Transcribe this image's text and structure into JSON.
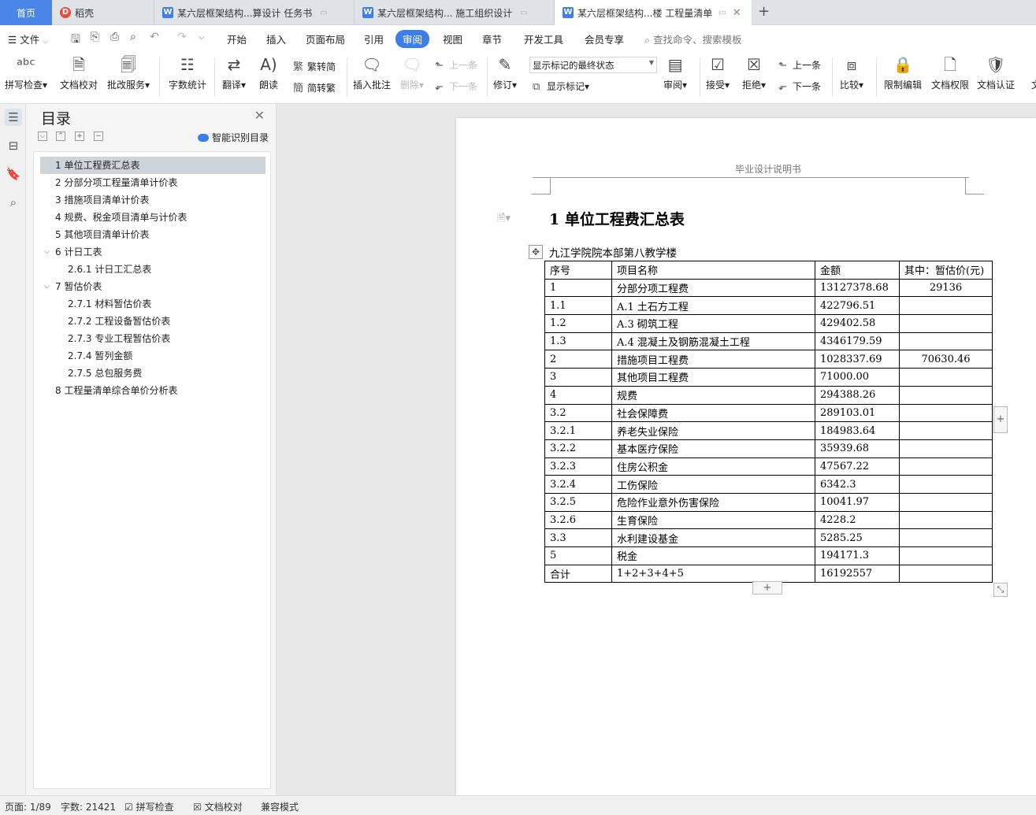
{
  "tabs": {
    "home": "首页",
    "t1": "稻壳",
    "t2": "某六层框架结构...算设计 任务书",
    "t3": "某六层框架结构... 施工组织设计",
    "t4": "某六层框架结构...楼 工程量清单"
  },
  "menu": {
    "file": "文件",
    "items": [
      "开始",
      "插入",
      "页面布局",
      "引用",
      "审阅",
      "视图",
      "章节",
      "开发工具",
      "会员专享"
    ],
    "search": "查找命令、搜索模板"
  },
  "ribbon": {
    "spell": "拼写检查",
    "proof": "文档校对",
    "revise_service": "批改服务",
    "wordcount": "字数统计",
    "translate": "翻译",
    "read_aloud": "朗读",
    "to_traditional": "繁转简",
    "to_simplified": "简转繁",
    "insert_comment": "插入批注",
    "delete": "删除",
    "prev": "上一条",
    "next": "下一条",
    "track": "修订",
    "display_state": "显示标记的最终状态",
    "show_markup": "显示标记",
    "review": "审阅",
    "accept": "接受",
    "reject": "拒绝",
    "prev2": "上一条",
    "next2": "下一条",
    "compare": "比较",
    "restrict": "限制编辑",
    "permission": "文档权限",
    "certify": "文档认证",
    "more": "文"
  },
  "toc": {
    "title": "目录",
    "smart": "智能识别目录",
    "items": [
      "1 单位工程费汇总表",
      "2 分部分项工程量清单计价表",
      "3 措施项目清单计价表",
      "4 规费、税金项目清单与计价表",
      "5 其他项目清单计价表",
      "6 计日工表",
      "2.6.1 计日工汇总表",
      "7 暂估价表",
      "2.7.1  材料暂估价表",
      "2.7.2 工程设备暂估价表",
      "2.7.3 专业工程暂估价表",
      "2.7.4 暂列金额",
      "2.7.5 总包服务费",
      "8 工程量清单综合单价分析表"
    ]
  },
  "doc": {
    "header": "毕业设计说明书",
    "heading": "1 单位工程费汇总表",
    "subtitle": "九江学院院本部第八教学楼",
    "table": [
      [
        "序号",
        "项目名称",
        "金额",
        "其中：暂估价(元)"
      ],
      [
        "1",
        "分部分项工程费",
        "13127378.68",
        "29136"
      ],
      [
        "1.1",
        "A.1 土石方工程",
        "422796.51",
        ""
      ],
      [
        "1.2",
        "A.3 砌筑工程",
        "429402.58",
        ""
      ],
      [
        "1.3",
        "A.4 混凝土及钢筋混凝土工程",
        "4346179.59",
        ""
      ],
      [
        "2",
        "措施项目工程费",
        "1028337.69",
        "70630.46"
      ],
      [
        "3",
        "其他项目工程费",
        "71000.00",
        ""
      ],
      [
        "4",
        "规费",
        "294388.26",
        ""
      ],
      [
        "3.2",
        "社会保障费",
        "289103.01",
        ""
      ],
      [
        "3.2.1",
        "养老失业保险",
        "184983.64",
        ""
      ],
      [
        "3.2.2",
        "基本医疗保险",
        "35939.68",
        ""
      ],
      [
        "3.2.3",
        "住房公积金",
        "47567.22",
        ""
      ],
      [
        "3.2.4",
        "工伤保险",
        "6342.3",
        ""
      ],
      [
        "3.2.5",
        "危险作业意外伤害保险",
        "10041.97",
        ""
      ],
      [
        "3.2.6",
        "生育保险",
        "4228.2",
        ""
      ],
      [
        "3.3",
        "水利建设基金",
        "5285.25",
        ""
      ],
      [
        "5",
        "税金",
        "194171.3",
        ""
      ],
      [
        "合计",
        "1+2+3+4+5",
        "16192557",
        ""
      ]
    ]
  },
  "status": {
    "page": "页面: 1/89",
    "words": "字数: 21421",
    "spell": "拼写检查",
    "proof": "文档校对",
    "compat": "兼容模式"
  }
}
